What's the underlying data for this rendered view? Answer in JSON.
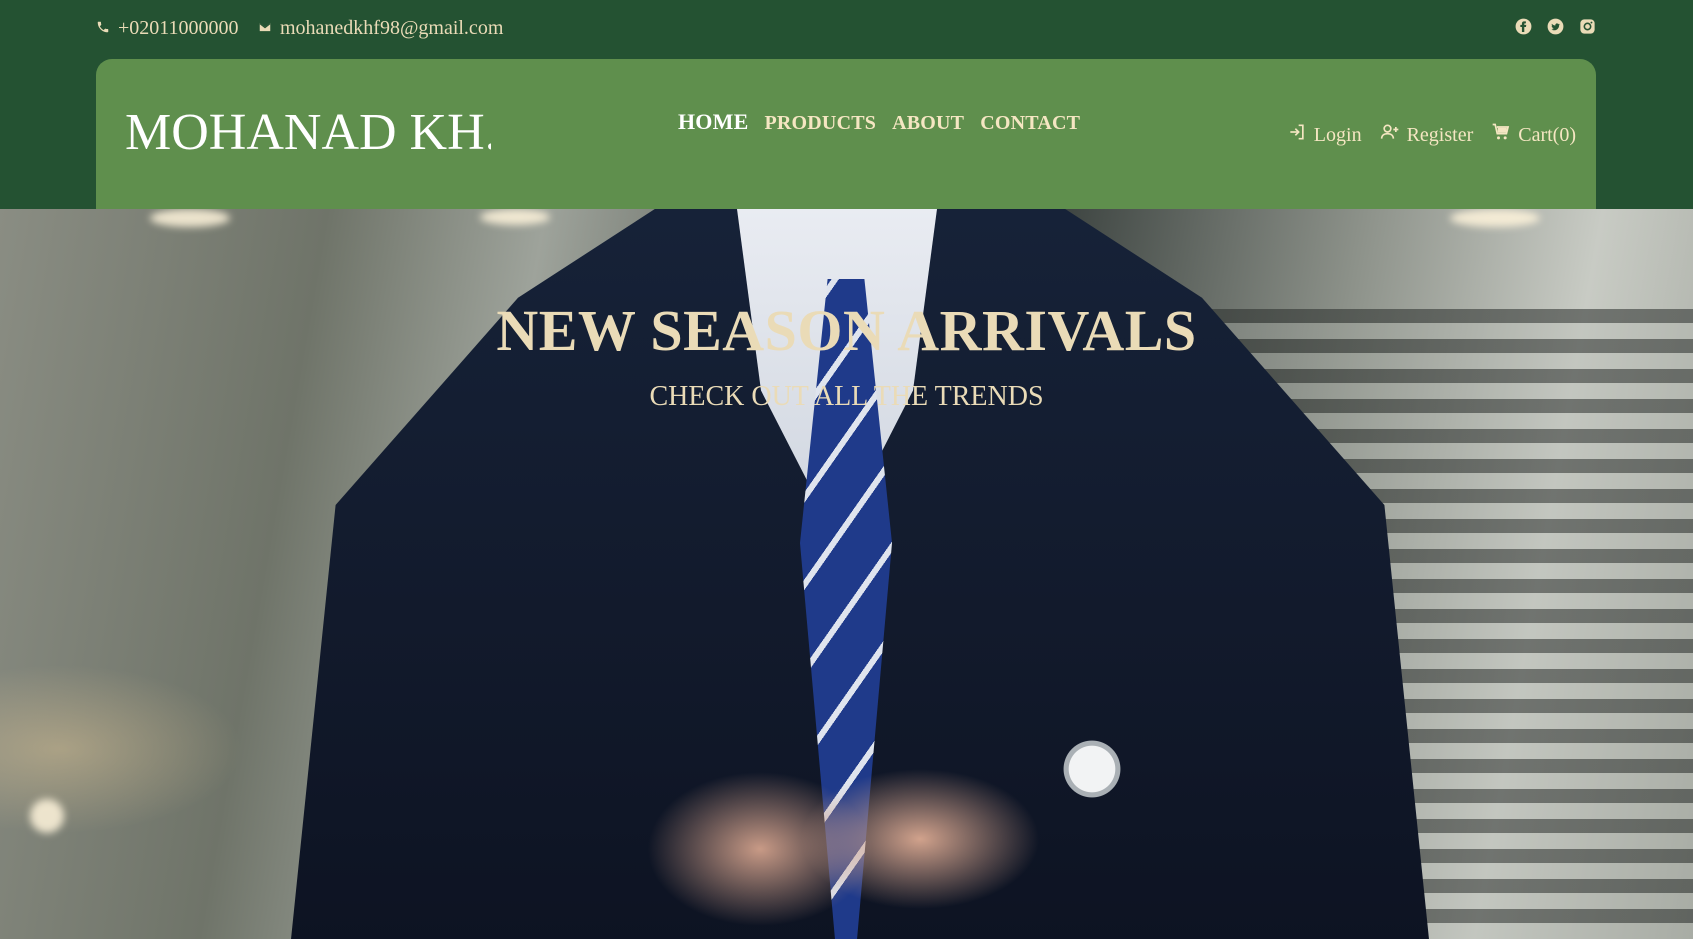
{
  "topbar": {
    "phone": "+02011000000",
    "email": "mohanedkhf98@gmail.com",
    "socials": [
      "facebook-icon",
      "twitter-icon",
      "instagram-icon"
    ]
  },
  "nav": {
    "brand": "MOHANAD KH.",
    "links": [
      {
        "label": "HOME",
        "active": true
      },
      {
        "label": "PRODUCTS",
        "active": false
      },
      {
        "label": "ABOUT",
        "active": false
      },
      {
        "label": "CONTACT",
        "active": false
      }
    ],
    "login_label": "Login",
    "register_label": "Register",
    "cart_label": "Cart(0)"
  },
  "hero": {
    "title": "NEW SEASON ARRIVALS",
    "subtitle": "CHECK OUT ALL THE TRENDS"
  },
  "colors": {
    "topbar_bg": "#245232",
    "nav_bg": "#5f8f4d",
    "accent_text": "#eadbb7"
  }
}
